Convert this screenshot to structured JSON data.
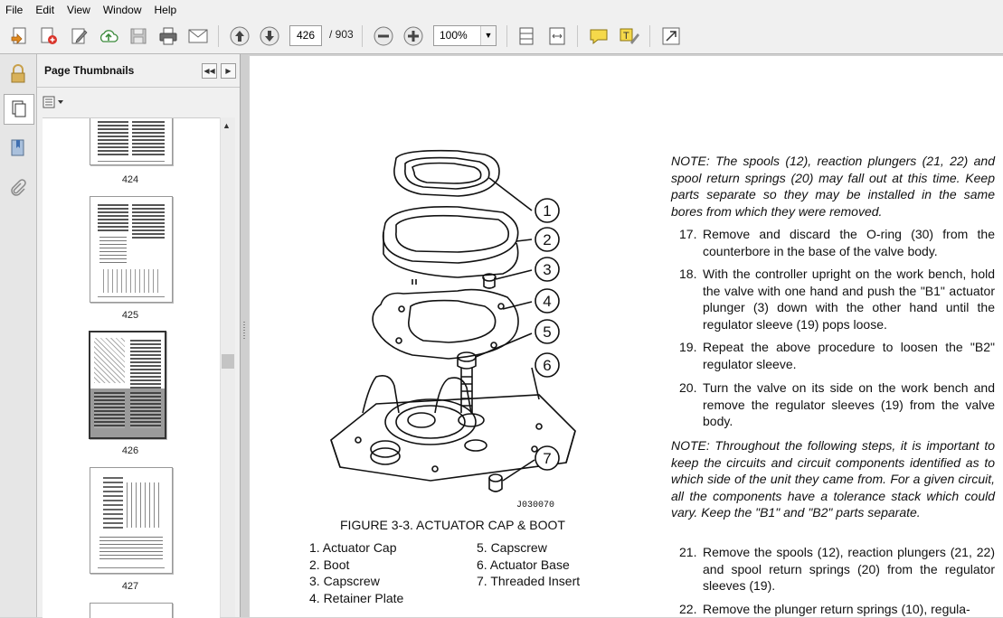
{
  "menu": [
    "File",
    "Edit",
    "View",
    "Window",
    "Help"
  ],
  "toolbar": {
    "page_current": "426",
    "page_total": "/ 903",
    "zoom": "100%"
  },
  "panel": {
    "title": "Page Thumbnails",
    "thumbnails": [
      {
        "label": "424"
      },
      {
        "label": "425"
      },
      {
        "label": "426",
        "selected": true
      },
      {
        "label": "427"
      }
    ]
  },
  "document": {
    "figure": {
      "caption": "FIGURE 3-3. ACTUATOR CAP & BOOT",
      "code": "J030070",
      "callouts": [
        "1",
        "2",
        "3",
        "4",
        "5",
        "6",
        "7"
      ],
      "legend_left": [
        "1. Actuator Cap",
        "2. Boot",
        "3. Capscrew",
        "4. Retainer Plate"
      ],
      "legend_right": [
        "5. Capscrew",
        "6. Actuator Base",
        "7. Threaded Insert"
      ]
    },
    "note1": "NOTE: The spools (12), reaction plungers (21, 22) and spool return springs (20) may fall out at this time. Keep parts separate so they may be installed in the same bores from which they were removed.",
    "steps_a": [
      {
        "num": "17.",
        "text": "Remove and discard the O-ring (30) from the counterbore in the base of the valve body."
      },
      {
        "num": "18.",
        "text": "With the controller upright on the work bench, hold the valve with one hand and push the \"B1\" actuator plunger (3) down with the other hand until the regulator sleeve (19) pops loose."
      },
      {
        "num": "19.",
        "text": "Repeat the above procedure to loosen the \"B2\" regulator sleeve."
      },
      {
        "num": "20.",
        "text": "Turn the valve on its side on the work bench and remove the regulator sleeves (19) from the valve body."
      }
    ],
    "note2": "NOTE: Throughout the following steps, it is important to keep the circuits and circuit components identified as to which side of the unit they came from. For a given circuit, all the components have a tolerance stack which could vary. Keep the \"B1\" and \"B2\" parts separate.",
    "steps_b": [
      {
        "num": "21.",
        "text": "Remove the spools (12), reaction plungers (21, 22) and spool return springs (20) from the regulator sleeves (19)."
      },
      {
        "num": "22.",
        "text": "Remove the plunger return springs (10), regula-"
      }
    ]
  },
  "colors": {
    "toolbar_bg": "#f0f0f0",
    "panel_bg": "#f0f0f0",
    "doc_bg": "#d0d0d0"
  }
}
